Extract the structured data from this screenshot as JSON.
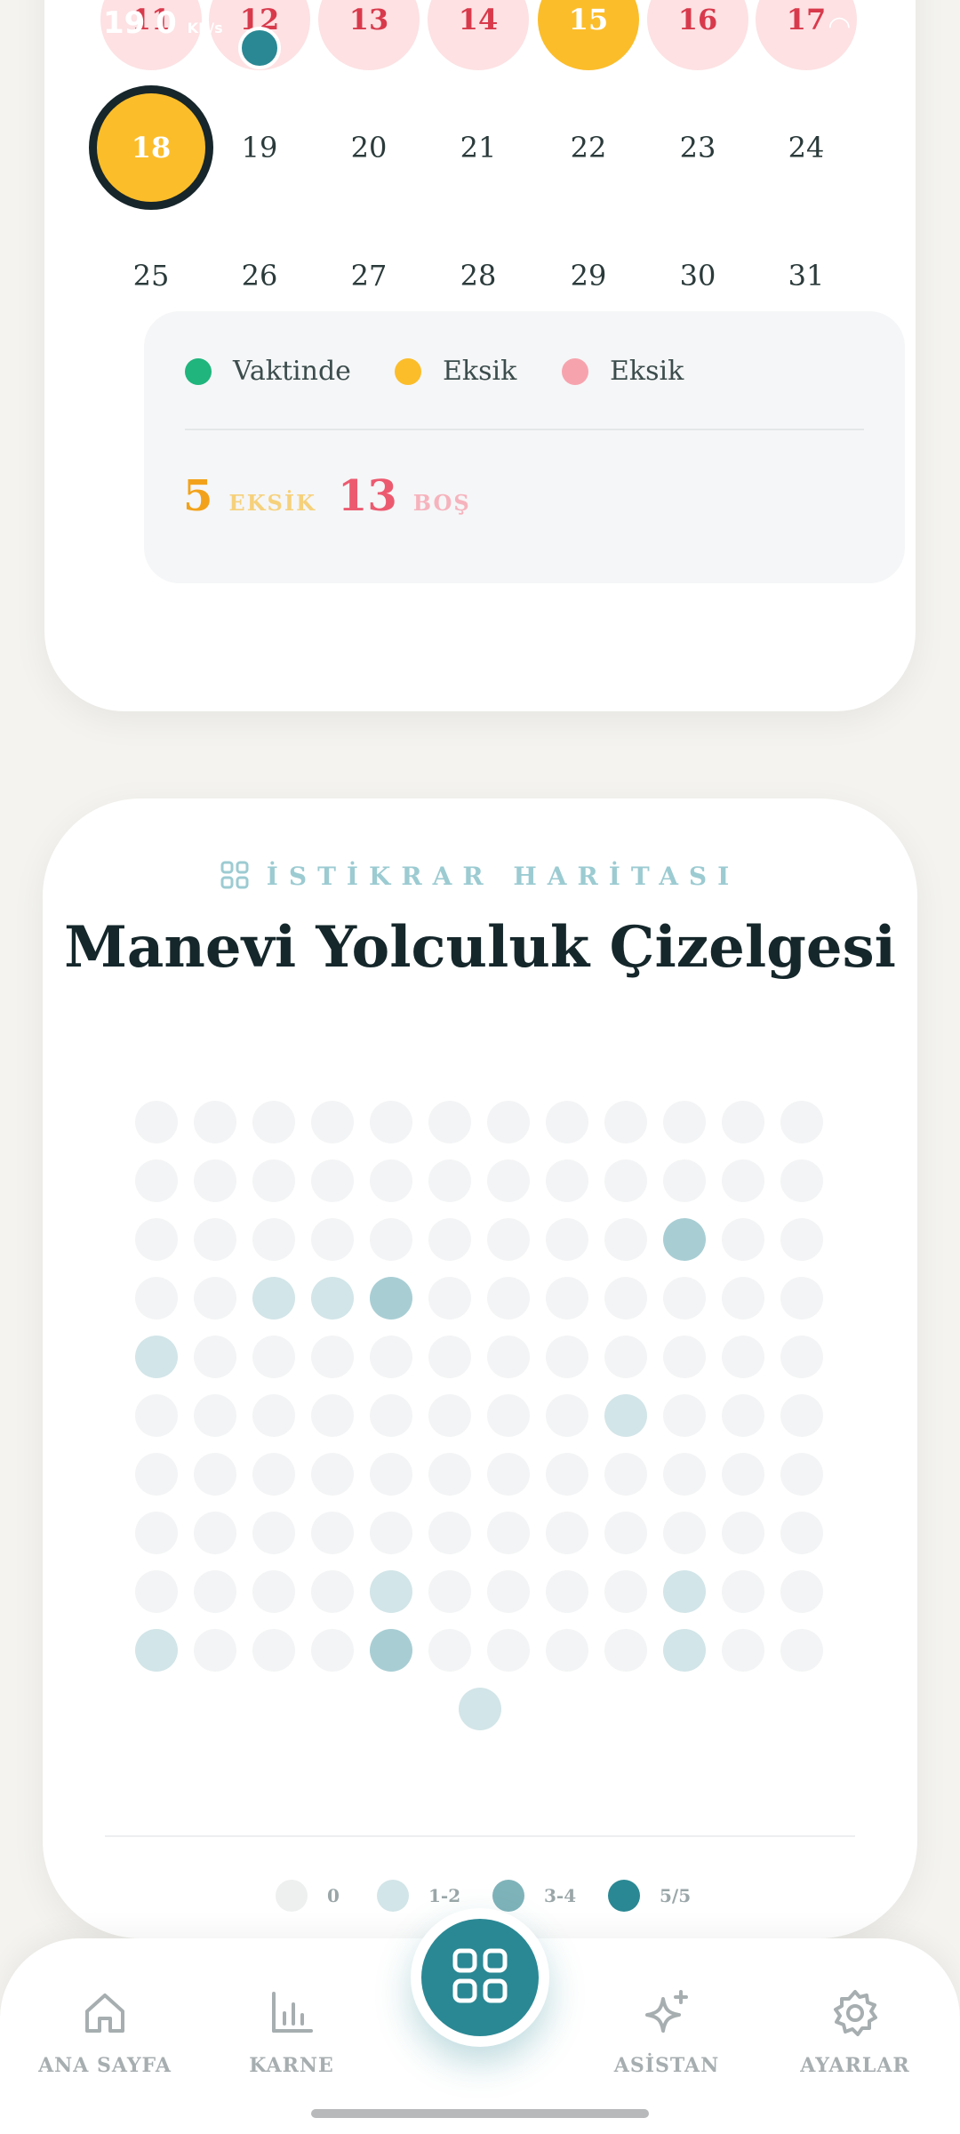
{
  "status_bar": {
    "time": "19",
    "net": "0",
    "net_unit": "KB/s"
  },
  "calendar": {
    "week_row_1": [
      {
        "day": "11",
        "state": "missed"
      },
      {
        "day": "12",
        "state": "missed",
        "indicator": true
      },
      {
        "day": "13",
        "state": "missed"
      },
      {
        "day": "14",
        "state": "missed"
      },
      {
        "day": "15",
        "state": "partial"
      },
      {
        "day": "16",
        "state": "missed"
      },
      {
        "day": "17",
        "state": "missed"
      }
    ],
    "week_row_2": [
      {
        "day": "18",
        "state": "today"
      },
      {
        "day": "19",
        "state": "none"
      },
      {
        "day": "20",
        "state": "none"
      },
      {
        "day": "21",
        "state": "none"
      },
      {
        "day": "22",
        "state": "none"
      },
      {
        "day": "23",
        "state": "none"
      },
      {
        "day": "24",
        "state": "none"
      }
    ],
    "week_row_3": [
      {
        "day": "25",
        "state": "none"
      },
      {
        "day": "26",
        "state": "none"
      },
      {
        "day": "27",
        "state": "none"
      },
      {
        "day": "28",
        "state": "none"
      },
      {
        "day": "29",
        "state": "none"
      },
      {
        "day": "30",
        "state": "none"
      },
      {
        "day": "31",
        "state": "none"
      }
    ],
    "legend": [
      {
        "label": "Vaktinde",
        "color": "#1fb57d"
      },
      {
        "label": "Eksik",
        "color": "#fbbd2a"
      },
      {
        "label": "Eksik",
        "color": "#f7a3ae"
      }
    ],
    "stats": [
      {
        "value": "5",
        "label": "EKSİK",
        "num_color": "#f2a21a",
        "label_color": "#f6d17c"
      },
      {
        "value": "13",
        "label": "BOŞ",
        "num_color": "#ec5a70",
        "label_color": "#f6b3bd"
      }
    ]
  },
  "map": {
    "eyebrow": "İSTİKRAR HARİTASI",
    "title": "Manevi Yolculuk Çizelgesi",
    "levels": [
      0,
      0,
      0,
      0,
      0,
      0,
      0,
      0,
      0,
      0,
      0,
      0,
      0,
      0,
      0,
      0,
      0,
      0,
      0,
      0,
      0,
      0,
      0,
      0,
      0,
      0,
      0,
      0,
      0,
      0,
      0,
      0,
      0,
      2,
      0,
      0,
      0,
      0,
      1,
      1,
      2,
      0,
      0,
      0,
      0,
      0,
      0,
      0,
      1,
      0,
      0,
      0,
      0,
      0,
      0,
      0,
      0,
      0,
      0,
      0,
      0,
      0,
      0,
      0,
      0,
      0,
      0,
      0,
      1,
      0,
      0,
      0,
      0,
      0,
      0,
      0,
      0,
      0,
      0,
      0,
      0,
      0,
      0,
      0,
      0,
      0,
      0,
      0,
      0,
      0,
      0,
      0,
      0,
      0,
      0,
      0,
      0,
      0,
      0,
      0,
      1,
      0,
      0,
      0,
      0,
      1,
      0,
      0,
      1,
      0,
      0,
      0,
      2,
      0,
      0,
      0,
      0,
      1,
      0,
      0,
      1
    ],
    "level_colors": [
      "#f3f4f5",
      "#d2e5e8",
      "#a8ced4",
      "#2a8894"
    ],
    "scale": [
      {
        "label": "0",
        "color": "#eeefef"
      },
      {
        "label": "1-2",
        "color": "#d2e5e8"
      },
      {
        "label": "3-4",
        "color": "#7fb3ba"
      },
      {
        "label": "5/5",
        "color": "#2a8894"
      }
    ]
  },
  "nav": {
    "items": [
      {
        "label": "ANA SAYFA",
        "icon": "home-icon"
      },
      {
        "label": "KARNE",
        "icon": "chart-icon"
      },
      {
        "label": "ASİSTAN",
        "icon": "sparkle-icon"
      },
      {
        "label": "AYARLAR",
        "icon": "gear-icon"
      }
    ],
    "fab_icon": "grid-icon"
  }
}
